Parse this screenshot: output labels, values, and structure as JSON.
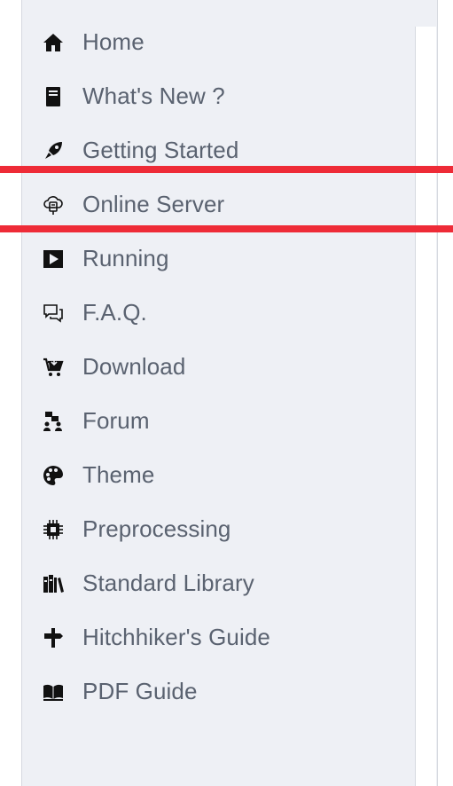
{
  "sidebar": {
    "items": [
      {
        "label": "Home",
        "icon": "home-icon"
      },
      {
        "label": "What's New ?",
        "icon": "book-icon"
      },
      {
        "label": "Getting Started",
        "icon": "rocket-icon"
      },
      {
        "label": "Online Server",
        "icon": "cloud-server-icon"
      },
      {
        "label": "Running",
        "icon": "play-icon"
      },
      {
        "label": "F.A.Q.",
        "icon": "chat-bubbles-icon"
      },
      {
        "label": "Download",
        "icon": "cart-icon"
      },
      {
        "label": "Forum",
        "icon": "users-discussion-icon"
      },
      {
        "label": "Theme",
        "icon": "palette-icon"
      },
      {
        "label": "Preprocessing",
        "icon": "chip-icon"
      },
      {
        "label": "Standard Library",
        "icon": "library-icon"
      },
      {
        "label": "Hitchhiker's Guide",
        "icon": "signpost-icon"
      },
      {
        "label": "PDF Guide",
        "icon": "open-book-icon"
      }
    ]
  },
  "highlight": {
    "color": "#ee2b37",
    "target": "Online Server"
  },
  "colors": {
    "sidebar_bg": "#eef0f5",
    "label_text": "#5a6270",
    "icon": "#111111"
  }
}
